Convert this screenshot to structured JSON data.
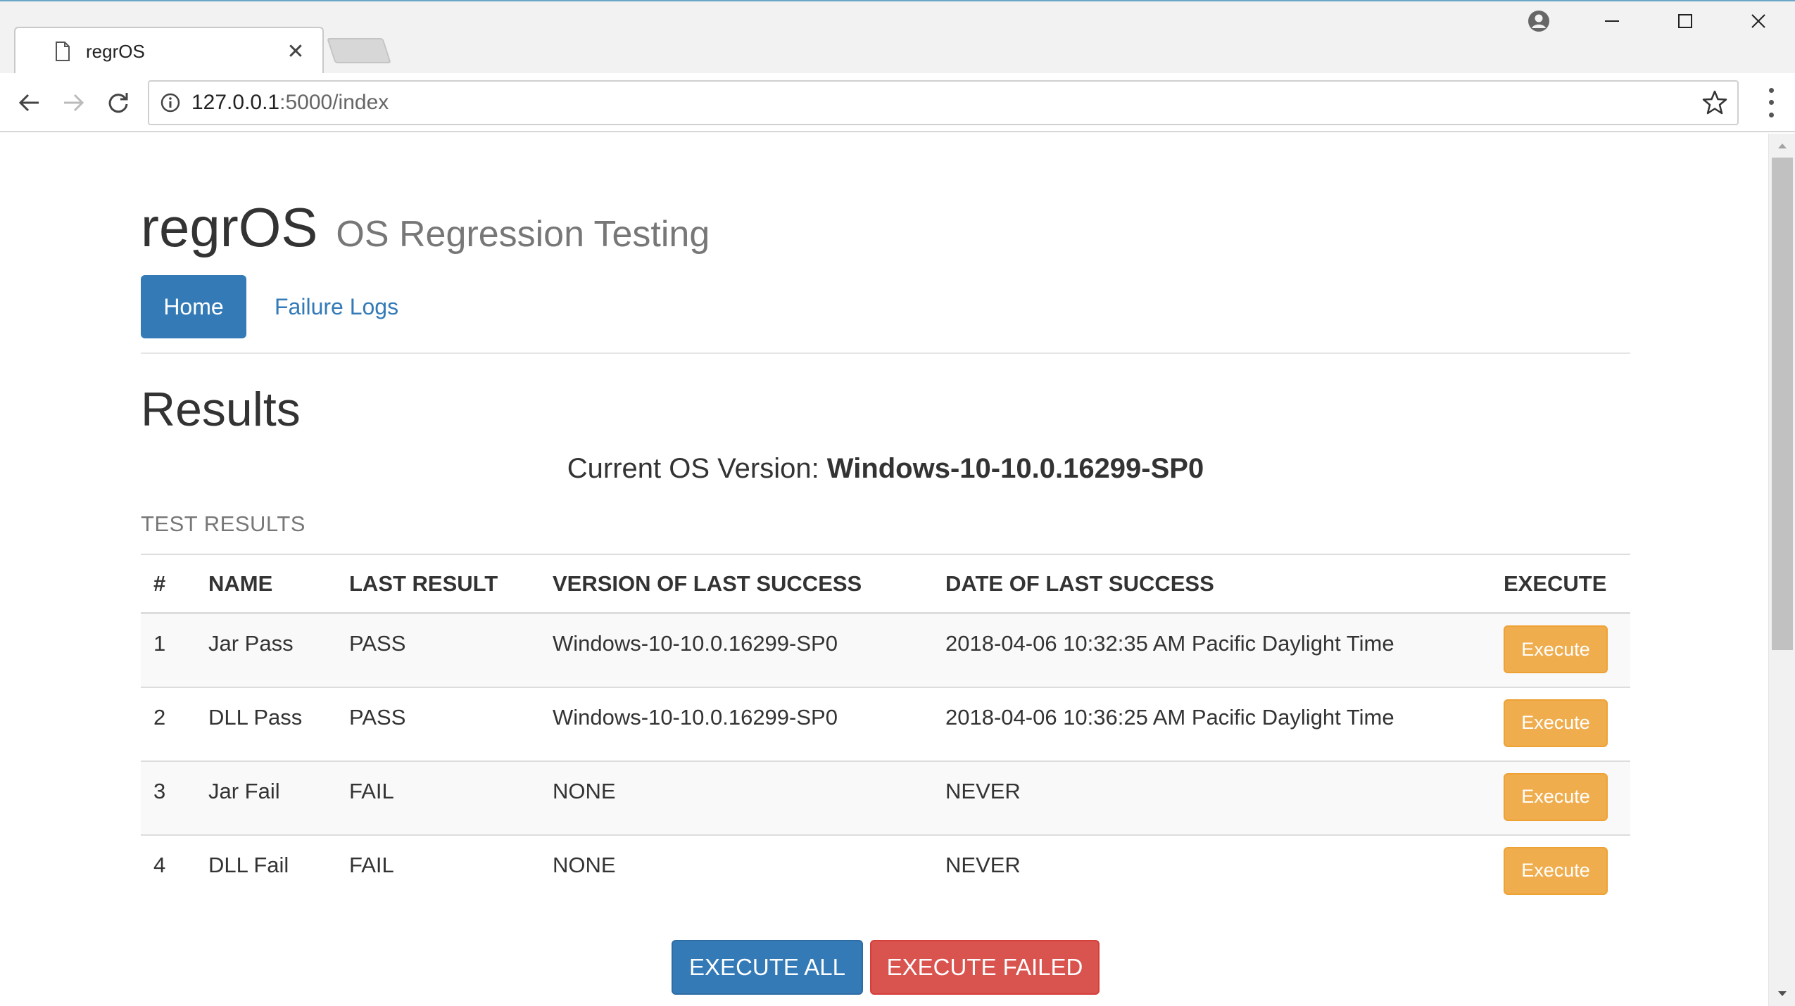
{
  "browser": {
    "tab_title": "regrOS",
    "url_host": "127.0.0.1",
    "url_path": ":5000/index"
  },
  "header": {
    "brand": "regrOS",
    "subtitle": "OS Regression Testing"
  },
  "nav": {
    "home": "Home",
    "failure_logs": "Failure Logs"
  },
  "results": {
    "title": "Results",
    "os_label": "Current OS Version: ",
    "os_value": "Windows-10-10.0.16299-SP0",
    "caption": "TEST RESULTS"
  },
  "table": {
    "headers": [
      "#",
      "NAME",
      "LAST RESULT",
      "VERSION OF LAST SUCCESS",
      "DATE OF LAST SUCCESS",
      "EXECUTE"
    ],
    "rows": [
      {
        "num": "1",
        "name": "Jar Pass",
        "result": "PASS",
        "version": "Windows-10-10.0.16299-SP0",
        "date": "2018-04-06 10:32:35 AM Pacific Daylight Time",
        "button": "Execute"
      },
      {
        "num": "2",
        "name": "DLL Pass",
        "result": "PASS",
        "version": "Windows-10-10.0.16299-SP0",
        "date": "2018-04-06 10:36:25 AM Pacific Daylight Time",
        "button": "Execute"
      },
      {
        "num": "3",
        "name": "Jar Fail",
        "result": "FAIL",
        "version": "NONE",
        "date": "NEVER",
        "button": "Execute"
      },
      {
        "num": "4",
        "name": "DLL Fail",
        "result": "FAIL",
        "version": "NONE",
        "date": "NEVER",
        "button": "Execute"
      }
    ]
  },
  "actions": {
    "execute_all": "EXECUTE ALL",
    "execute_failed": "EXECUTE FAILED"
  },
  "colors": {
    "primary": "#337ab7",
    "warning": "#f0ad4e",
    "danger": "#d9534f"
  }
}
